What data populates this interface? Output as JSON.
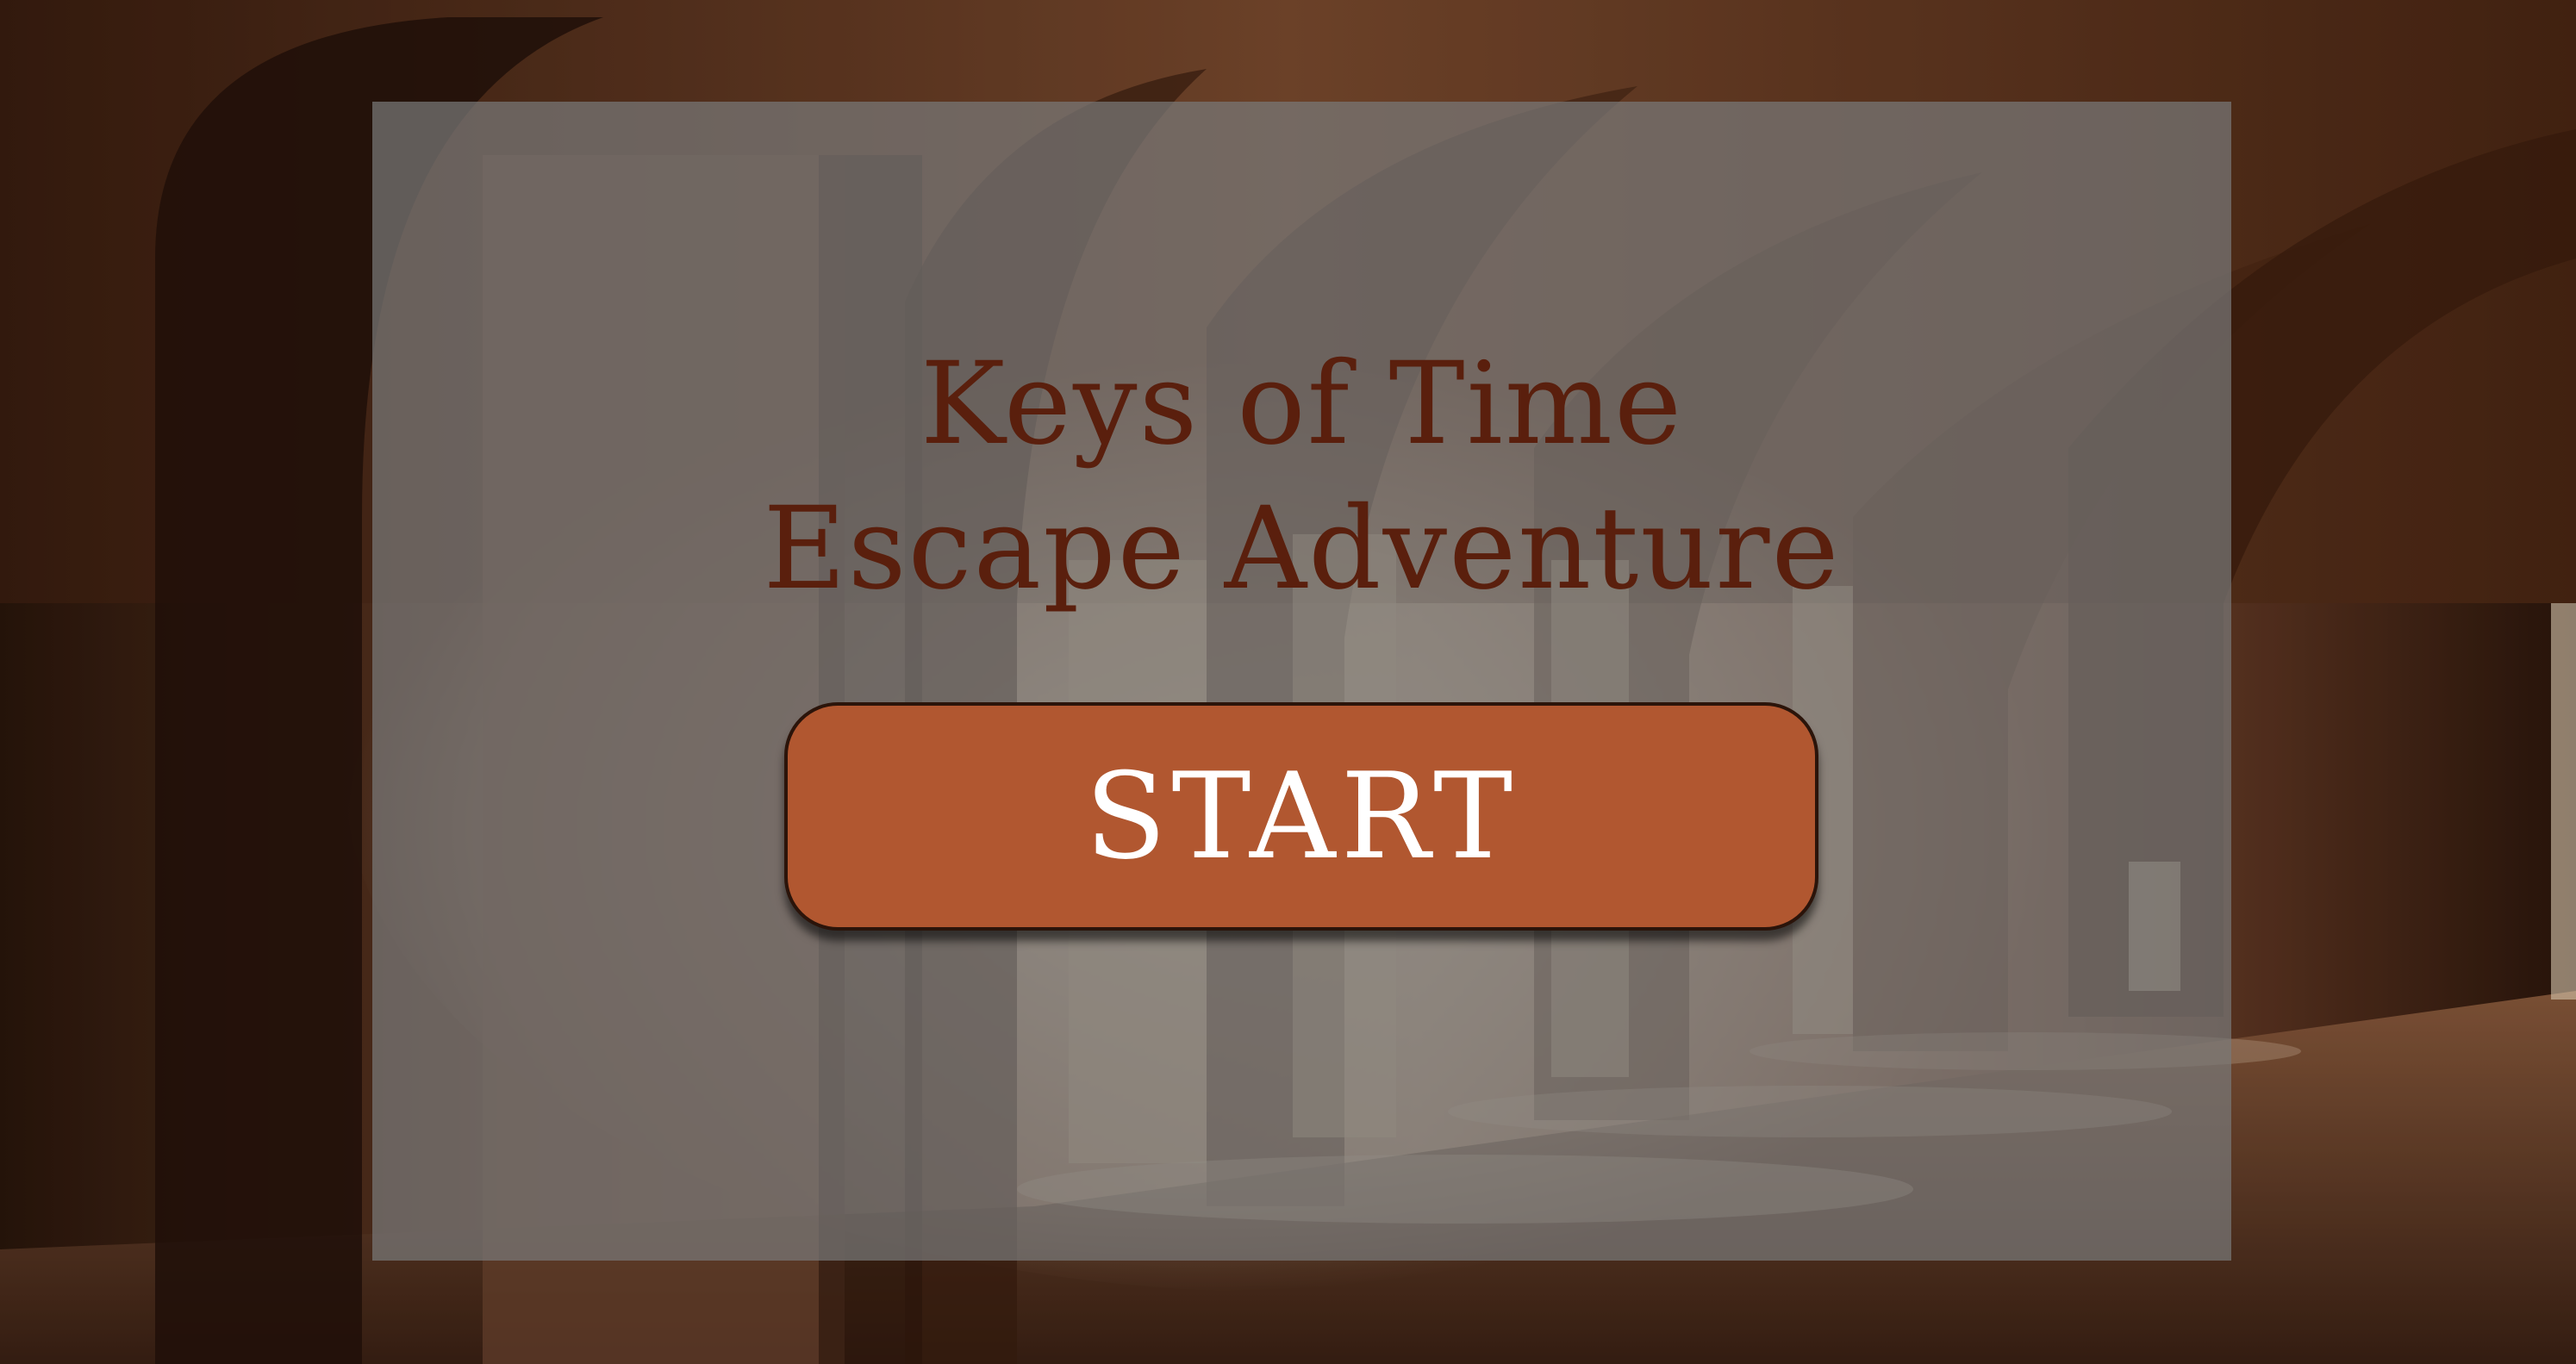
{
  "game": {
    "title_line1": "Keys of Time",
    "title_line2": "Escape Adventure",
    "start_label": "START"
  },
  "colors": {
    "title": "#5a1f0d",
    "button": "#b15730",
    "button_text": "#ffffff",
    "panel": "#787878"
  },
  "background": {
    "scene": "vaulted stone cloister corridor with arches and sunlight"
  }
}
